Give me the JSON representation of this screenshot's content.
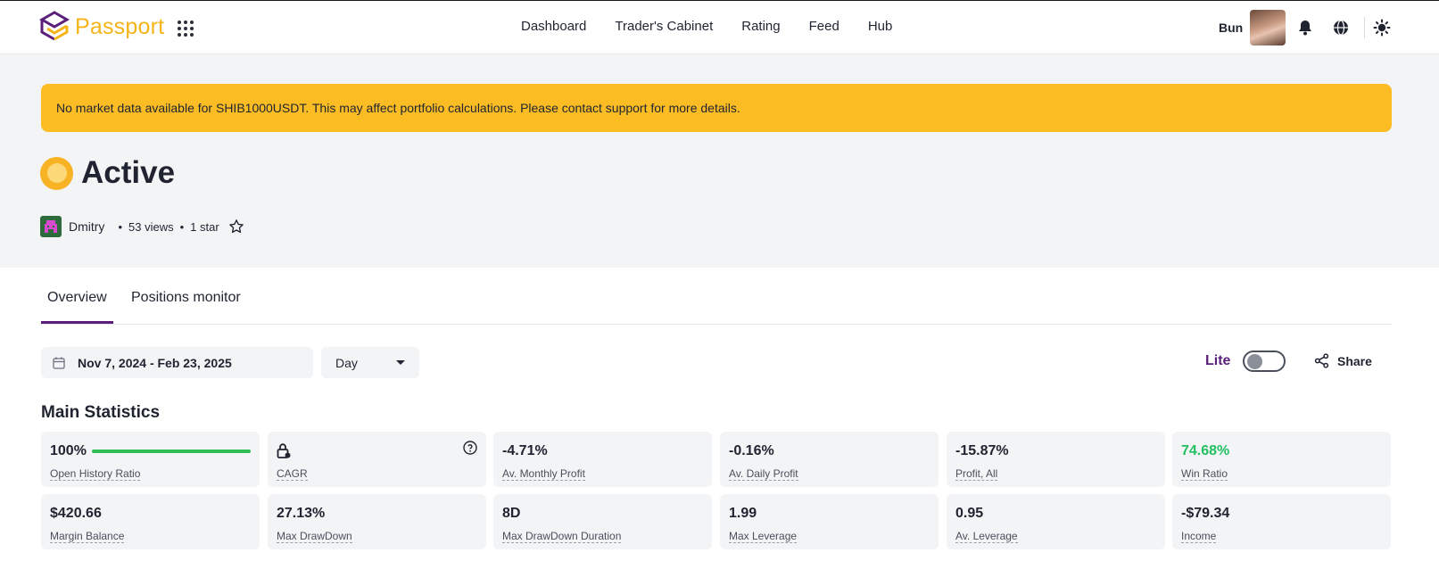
{
  "header": {
    "brand": "Passport",
    "nav": [
      "Dashboard",
      "Trader's Cabinet",
      "Rating",
      "Feed",
      "Hub"
    ],
    "user_name": "Bun",
    "icons": [
      "apps-grid-icon",
      "bell-icon",
      "globe-icon",
      "sun-icon"
    ]
  },
  "alert": {
    "message": "No market data available for SHIB1000USDT. This may affect portfolio calculations. Please contact support for more details."
  },
  "portfolio": {
    "title": "Active",
    "author": "Dmitry",
    "views": "53 views",
    "stars": "1 star"
  },
  "tabs": [
    "Overview",
    "Positions monitor"
  ],
  "active_tab": "Overview",
  "controls": {
    "date_range": "Nov 7, 2024 - Feb 23, 2025",
    "period": "Day",
    "lite_label": "Lite",
    "lite_enabled": false,
    "share_label": "Share"
  },
  "statistics": {
    "title": "Main Statistics",
    "open_history_ratio": {
      "value": "100%",
      "label": "Open History Ratio",
      "progress": 1.0
    },
    "cagr": {
      "value": "",
      "label": "CAGR",
      "locked": true
    },
    "av_monthly_profit": {
      "value": "-4.71%",
      "label": "Av. Monthly Profit"
    },
    "av_daily_profit": {
      "value": "-0.16%",
      "label": "Av. Daily Profit"
    },
    "profit_all": {
      "value": "-15.87%",
      "label": "Profit, All"
    },
    "win_ratio": {
      "value": "74.68%",
      "label": "Win Ratio",
      "color": "#22c061"
    },
    "margin_balance": {
      "value": "$420.66",
      "label": "Margin Balance"
    },
    "max_drawdown": {
      "value": "27.13%",
      "label": "Max DrawDown"
    },
    "max_drawdown_duration": {
      "value": "8D",
      "label": "Max DrawDown Duration"
    },
    "max_leverage": {
      "value": "1.99",
      "label": "Max Leverage"
    },
    "av_leverage": {
      "value": "0.95",
      "label": "Av. Leverage"
    },
    "income": {
      "value": "-$79.34",
      "label": "Income"
    }
  },
  "colors": {
    "brand_yellow": "#f5b418",
    "brand_purple": "#5b1f7a",
    "alert_bg": "#fbbc24",
    "positive": "#22c061"
  }
}
